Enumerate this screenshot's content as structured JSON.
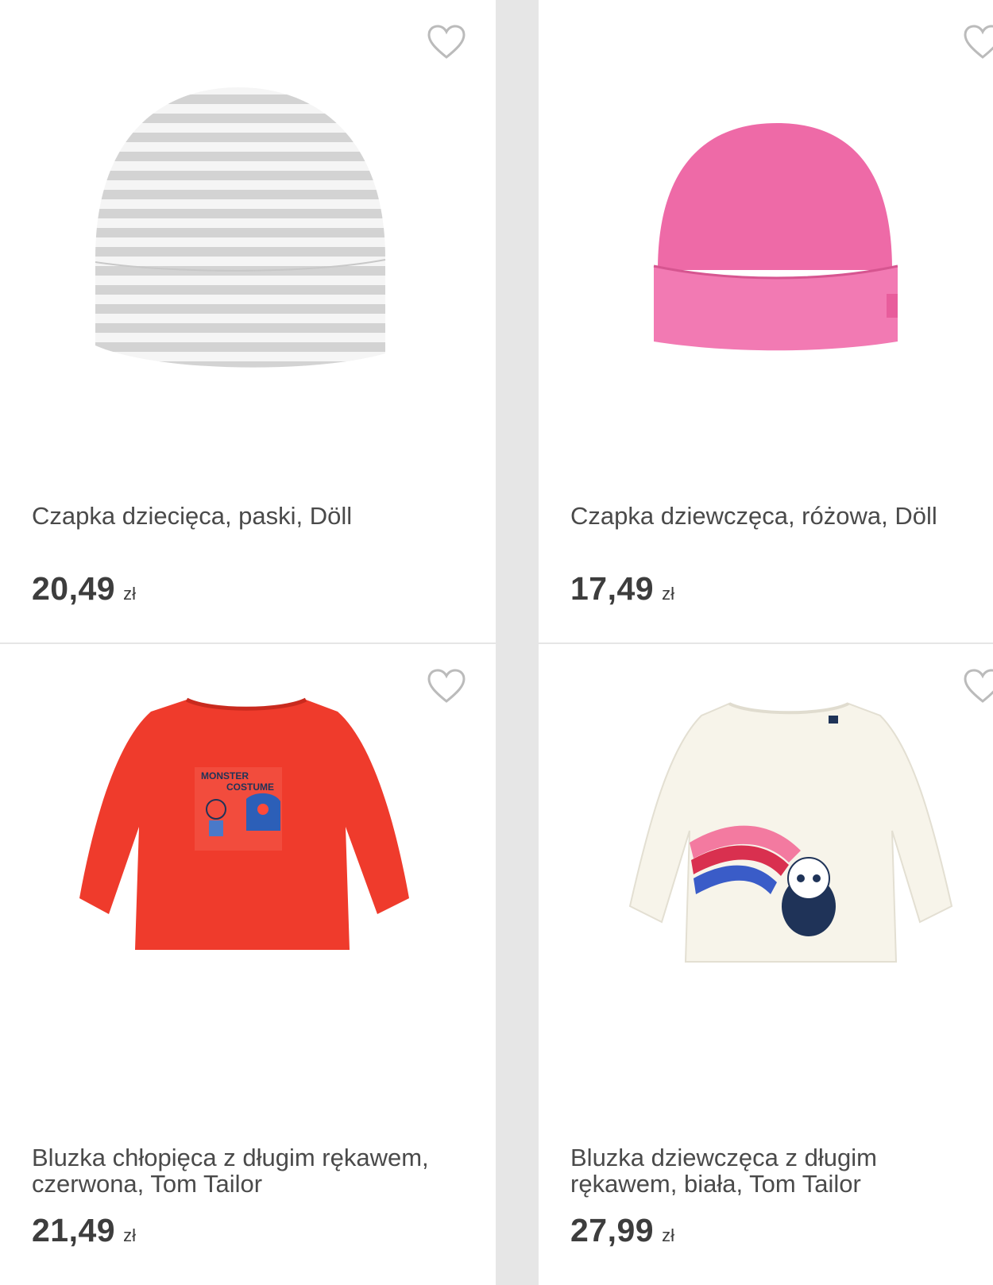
{
  "products": [
    {
      "title": "Czapka dziecięca, paski, Döll",
      "price": "20,49",
      "currency": "zł",
      "image": "striped-grey-baby-hat",
      "favorite_icon": "heart-outline-icon"
    },
    {
      "title": "Czapka dziewczęca, różowa, Döll",
      "price": "17,49",
      "currency": "zł",
      "image": "pink-baby-hat",
      "favorite_icon": "heart-outline-icon"
    },
    {
      "title": "Bluzka chłopięca z długim rękawem, czerwona, Tom Tailor",
      "price": "21,49",
      "currency": "zł",
      "image": "red-long-sleeve-shirt",
      "print_text_1": "MONSTER",
      "print_text_2": "COSTUME",
      "favorite_icon": "heart-outline-icon"
    },
    {
      "title": "Bluzka dziewczęca z długim rękawem, biała, Tom Tailor",
      "price": "27,99",
      "currency": "zł",
      "image": "white-long-sleeve-shirt-panda",
      "favorite_icon": "heart-outline-icon"
    }
  ]
}
